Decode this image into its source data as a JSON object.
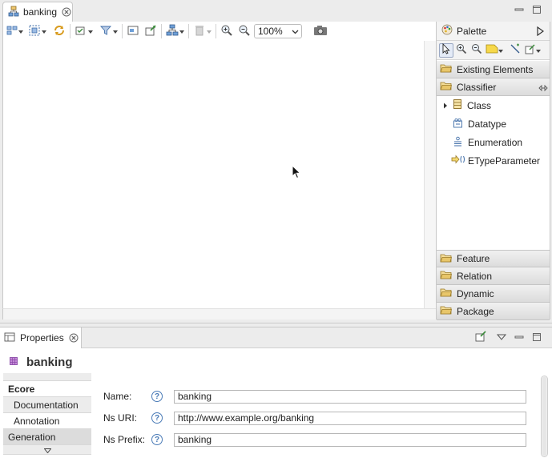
{
  "editor": {
    "tab_label": "banking",
    "icons": [
      "ecore-diagram-icon",
      "close-icon",
      "minimize-icon",
      "maximize-icon"
    ]
  },
  "toolbar": {
    "zoom_value": "100%",
    "icons": [
      "select-all-icon",
      "arrange-icon",
      "refresh-icon",
      "layers-icon",
      "filter-icon",
      "show-properties-icon",
      "new-diagram-icon",
      "layout-icon",
      "delete-icon",
      "zoom-in-icon",
      "zoom-out-icon",
      "camera-icon"
    ]
  },
  "palette": {
    "title": "Palette",
    "drawers_top": [
      {
        "label": "Existing Elements"
      },
      {
        "label": "Classifier"
      }
    ],
    "entries": [
      {
        "label": "Class",
        "icon": "class-icon"
      },
      {
        "label": "Datatype",
        "icon": "datatype-icon"
      },
      {
        "label": "Enumeration",
        "icon": "enumeration-icon"
      },
      {
        "label": "ETypeParameter",
        "icon": "etypeparameter-icon"
      }
    ],
    "drawers_bottom": [
      {
        "label": "Feature"
      },
      {
        "label": "Relation"
      },
      {
        "label": "Dynamic"
      },
      {
        "label": "Package"
      }
    ]
  },
  "properties": {
    "tab_label": "Properties",
    "title": "banking",
    "categories": [
      {
        "label": "Ecore",
        "active": true
      },
      {
        "label": "Documentation",
        "sub": true
      },
      {
        "label": "Annotation",
        "sub": true
      },
      {
        "label": "Generation"
      }
    ],
    "fields": [
      {
        "label": "Name:",
        "value": "banking"
      },
      {
        "label": "Ns URI:",
        "value": "http://www.example.org/banking"
      },
      {
        "label": "Ns Prefix:",
        "value": "banking"
      }
    ]
  },
  "colors": {
    "accent_blue": "#4a7bb7",
    "folder_yellow": "#e8c66a",
    "package_purple": "#8a4aa8"
  }
}
